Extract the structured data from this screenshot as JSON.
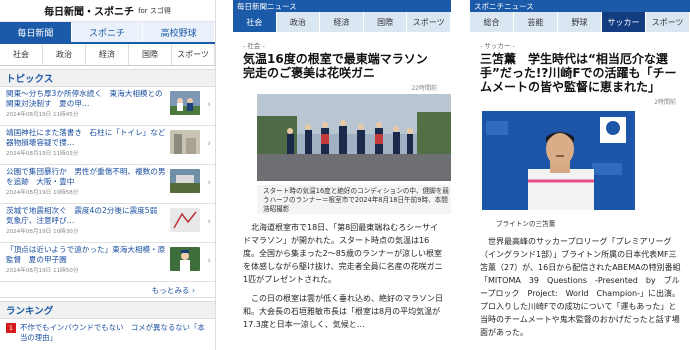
{
  "panel1": {
    "header": {
      "brand": "毎日新聞・スポニチ",
      "brand_sub": "for スゴ得"
    },
    "tabs": [
      "毎日新聞",
      "スポニチ",
      "高校野球"
    ],
    "categories": [
      "社会",
      "政治",
      "経済",
      "国際",
      "スポーツ"
    ],
    "topics_heading": "トピックス",
    "news": [
      {
        "title": "関東～分ち厚3か所停水続く　東海大相模との関東対決制す　夏の甲…",
        "date": "2024年08月19日 11時45分"
      },
      {
        "title": "靖国神社にまた落書き　石柱に「トイレ」など　器物損壊容疑で捜…",
        "date": "2024年08月19日 11時03分"
      },
      {
        "title": "公園で集団暴行か　男性が重傷不明、複数の男を追跡　大阪・豊中",
        "date": "2024年08月19日 10時58分"
      },
      {
        "title": "茨城で地震相次ぐ　震度4の2分後に震度5弱　気象庁、注意呼び…",
        "date": "2024年08月19日 10時30分"
      },
      {
        "title": "「頂点は近いようで遠かった」東海大相模・原監督　夏の甲子園",
        "date": "2024年08月19日 11時50分"
      }
    ],
    "more_label": "もっとみる",
    "ranking_heading": "ランキング",
    "ranking": [
      {
        "num": "1",
        "title": "不作でもインバウンドでもない　コメが異なるない「本当の理由」"
      }
    ]
  },
  "panel2": {
    "header": "毎日新聞ニュース",
    "tabs": [
      "社会",
      "政治",
      "経済",
      "国際",
      "スポーツ"
    ],
    "section": "- 社会 -",
    "headline": "気温16度の根室で最東端マラソン　完走のご褒美は花咲ガニ",
    "ago": "22時間前",
    "caption": "スタート時の気温16度と絶好のコンディションの中、健脚を競うハーフのランナー＝根室市で2024年8月18日午前9時、本間浩昭撮影",
    "body": [
      "北海道根室市で18日、「第8回最東端ねむろシーサイドマラソン」が開かれた。スタート時点の気温は16度。全国から集まった2～85歳のランナーが涼しい根室を体感しながら駆け抜け、完走者全員に名産の花咲ガニ1匹がプレゼントされた。",
      "この日の根室は雲が低く垂れ込め、絶好のマラソン日和。大会長の石垣雅敏市長は「根室は8月の平均気温が17.3度と日本一涼しく、気候と…"
    ]
  },
  "panel3": {
    "header": "スポニチニュース",
    "tabs": [
      "総合",
      "芸能",
      "野球",
      "サッカー",
      "スポーツ"
    ],
    "section": "- サッカー -",
    "headline": "三笘薫　学生時代は“相当厄介な選手”だった!?川崎Fでの活躍も「チームメートの皆や監督に恵まれた」",
    "ago": "2時間前",
    "caption": "ブライトンの三笘薫",
    "body": "世界最高峰のサッカープロリーグ「プレミアリーグ（イングランド1部）」ブライトン所属の日本代表MF三笘薫（27）が、16日から配信されたABEMAの特別番組「MITOMA　39　Questions　-Presented　by　ブループロック　Project:　World　Champion-」に出演。プロ入りした川崎Fでの成功について「運もあった」と当時のチームメートや鬼木監督のおかげだったと話す場面があった。"
  },
  "colors": {
    "brand_blue": "#1a5aa8",
    "tab_dark": "#133b80",
    "rank_red": "#d61c1c"
  }
}
